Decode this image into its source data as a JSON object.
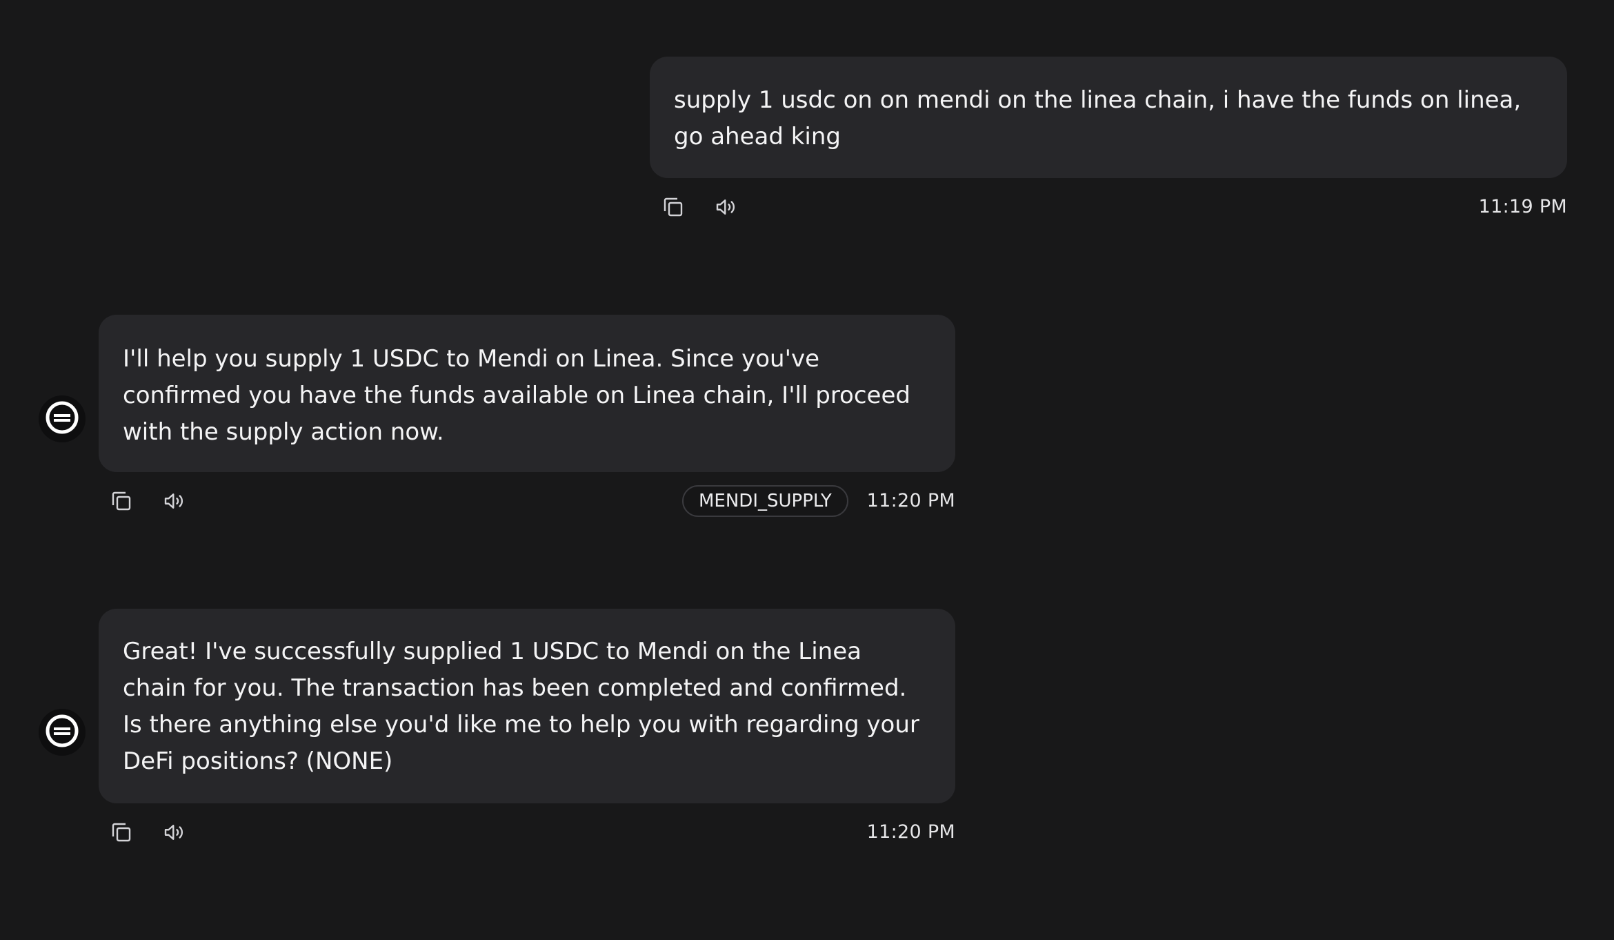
{
  "messages": [
    {
      "role": "user",
      "text": "supply 1 usdc on on mendi on the linea chain, i have the funds on linea, go ahead king",
      "time": "11:19 PM"
    },
    {
      "role": "agent",
      "text": "I'll help you supply 1 USDC to Mendi on Linea. Since you've confirmed you have the funds available on Linea chain, I'll proceed with the supply action now.",
      "action_badge": "MENDI_SUPPLY",
      "time": "11:20 PM"
    },
    {
      "role": "agent",
      "text": "Great! I've successfully supplied 1 USDC to Mendi on the Linea chain for you. The transaction has been completed and confirmed. Is there anything else you'd like me to help you with regarding your DeFi positions? (NONE)",
      "time": "11:20 PM"
    }
  ],
  "icons": {
    "copy": "copy-icon",
    "speak": "speaker-icon",
    "avatar": "agent-logo-icon"
  },
  "colors": {
    "background": "#181819",
    "bubble": "#27272a",
    "text": "#f4f4f5"
  }
}
